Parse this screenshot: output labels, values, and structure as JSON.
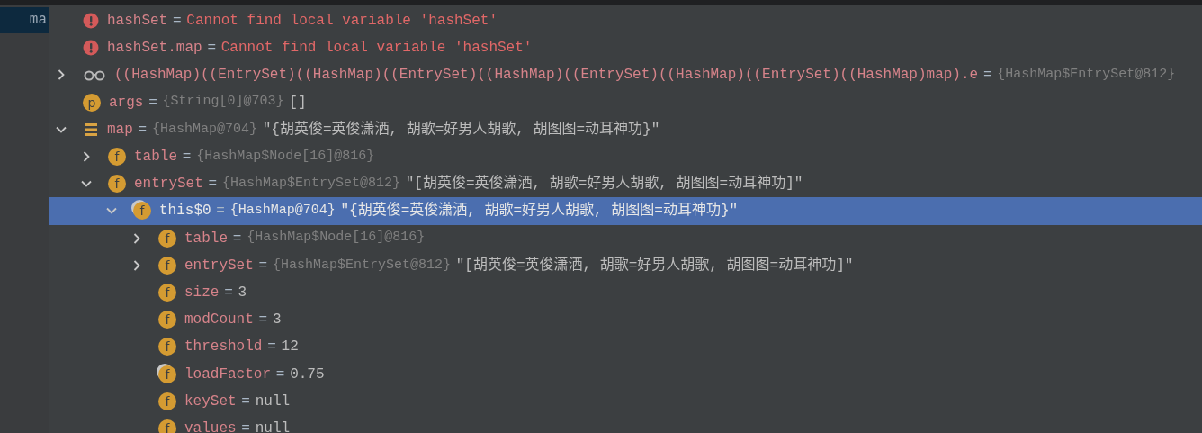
{
  "side_panel": {
    "items": [
      {
        "label": "ma",
        "selected": true
      }
    ]
  },
  "variables": [
    {
      "kind": "error",
      "name": "hashSet",
      "separator": "=",
      "value": "Cannot find local variable 'hashSet'",
      "selected": false
    },
    {
      "kind": "error",
      "name": "hashSet.map",
      "separator": "=",
      "value": "Cannot find local variable 'hashSet'",
      "selected": false
    },
    {
      "kind": "watch",
      "name": "((HashMap)((EntrySet)((HashMap)((EntrySet)((HashMap)((EntrySet)((HashMap)((EntrySet)((HashMap)map).e",
      "separator": "=",
      "type": "{HashMap$EntrySet@812}",
      "expanded": false,
      "selected": false
    },
    {
      "kind": "param",
      "badge": "p",
      "name": "args",
      "separator": "=",
      "type": "{String[0]@703}",
      "value": "[]",
      "selected": false
    },
    {
      "kind": "object",
      "name": "map",
      "separator": "=",
      "type": "{HashMap@704}",
      "value": "\"{胡英俊=英俊潇洒, 胡歌=好男人胡歌, 胡图图=动耳神功}\"",
      "expanded": true,
      "selected": false,
      "children": [
        {
          "kind": "field",
          "badge": "f",
          "name": "table",
          "separator": "=",
          "type": "{HashMap$Node[16]@816}",
          "expanded": false,
          "selected": false,
          "final": false
        },
        {
          "kind": "field",
          "badge": "f",
          "name": "entrySet",
          "separator": "=",
          "type": "{HashMap$EntrySet@812}",
          "value": "\"[胡英俊=英俊潇洒, 胡歌=好男人胡歌, 胡图图=动耳神功]\"",
          "expanded": true,
          "selected": false,
          "final": false,
          "children": [
            {
              "kind": "field",
              "badge": "f",
              "name": "this$0",
              "separator": "=",
              "type": "{HashMap@704}",
              "value": "\"{胡英俊=英俊潇洒, 胡歌=好男人胡歌, 胡图图=动耳神功}\"",
              "expanded": true,
              "selected": true,
              "final": true,
              "children": [
                {
                  "kind": "field",
                  "badge": "f",
                  "name": "table",
                  "separator": "=",
                  "type": "{HashMap$Node[16]@816}",
                  "expanded": false,
                  "selected": false,
                  "final": false
                },
                {
                  "kind": "field",
                  "badge": "f",
                  "name": "entrySet",
                  "separator": "=",
                  "type": "{HashMap$EntrySet@812}",
                  "value": "\"[胡英俊=英俊潇洒, 胡歌=好男人胡歌, 胡图图=动耳神功]\"",
                  "expanded": false,
                  "selected": false,
                  "final": false
                },
                {
                  "kind": "field",
                  "badge": "f",
                  "name": "size",
                  "separator": "=",
                  "value": "3",
                  "selected": false,
                  "final": false
                },
                {
                  "kind": "field",
                  "badge": "f",
                  "name": "modCount",
                  "separator": "=",
                  "value": "3",
                  "selected": false,
                  "final": false
                },
                {
                  "kind": "field",
                  "badge": "f",
                  "name": "threshold",
                  "separator": "=",
                  "value": "12",
                  "selected": false,
                  "final": false
                },
                {
                  "kind": "field",
                  "badge": "f",
                  "name": "loadFactor",
                  "separator": "=",
                  "value": "0.75",
                  "selected": false,
                  "final": true
                },
                {
                  "kind": "field",
                  "badge": "f",
                  "name": "keySet",
                  "separator": "=",
                  "value": "null",
                  "selected": false,
                  "final": false
                },
                {
                  "kind": "field",
                  "badge": "f",
                  "name": "values",
                  "separator": "=",
                  "value": "null",
                  "selected": false,
                  "final": false
                }
              ]
            }
          ]
        }
      ]
    }
  ]
}
